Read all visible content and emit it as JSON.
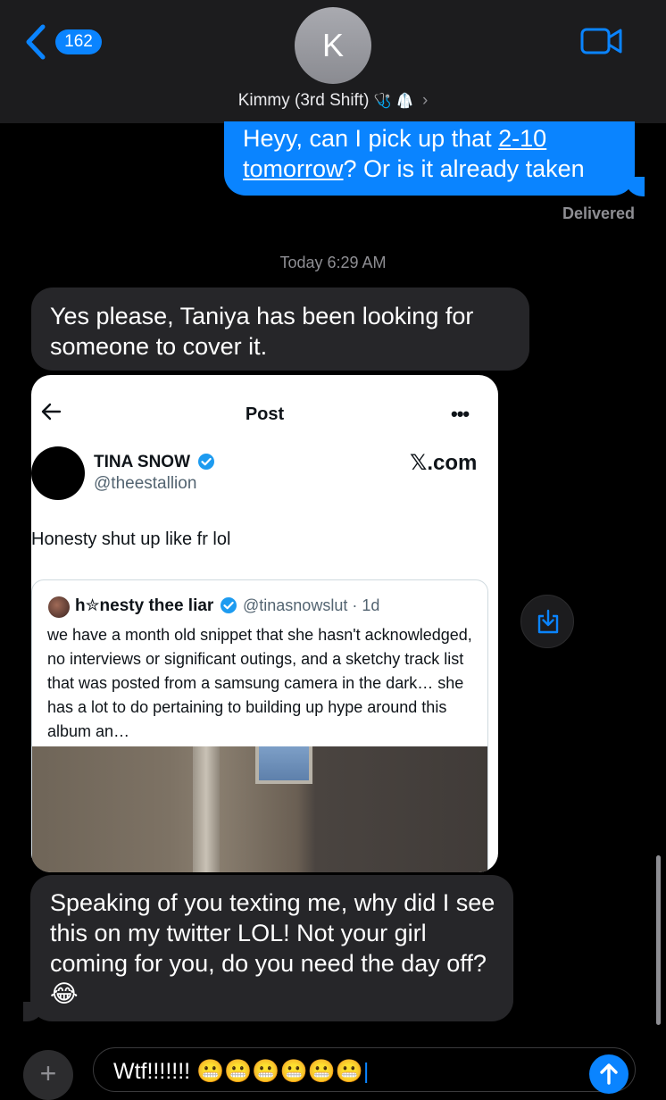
{
  "header": {
    "unread_count": "162",
    "avatar_initial": "K",
    "contact_name": "Kimmy (3rd Shift)",
    "contact_emoji": "🩺 🥼",
    "chevron": "›"
  },
  "messages": {
    "sent_1": {
      "text_before_link": "Heyy, can I pick up that ",
      "link_text": "2-10 tomorrow",
      "text_after_link": "? Or is it already taken",
      "status": "Delivered"
    },
    "timestamp": "Today 6:29 AM",
    "received_1": "Yes please, Taniya has been looking for someone to cover it.",
    "received_2": "Speaking of you texting me, why did I see this on my twitter LOL! Not your girl coming for you, do you need the day off? 😂"
  },
  "tweet": {
    "page_title": "Post",
    "more_label": "•••",
    "author_name": "TINA SNOW",
    "author_handle": "@theestallion",
    "site_label": "𝕏.com",
    "text": "Honesty shut up like fr lol",
    "quote": {
      "author_name": "h✮nesty thee liar",
      "meta": "@tinasnowslut · 1d",
      "text": "we have a month old snippet that she hasn't acknowledged, no interviews or significant outings, and a sketchy track list that was posted from a samsung camera in the dark… she has a lot to do pertaining to building up hype around this album an…"
    }
  },
  "compose": {
    "plus_label": "+",
    "text": "Wtf!!!!!!! 😬😬😬😬😬😬"
  },
  "colors": {
    "accent": "#0a84ff",
    "received_bubble": "#262629",
    "header_bg": "#1c1c1e",
    "twitter_verified": "#1d9bf0"
  },
  "icons": {
    "back": "chevron-left-icon",
    "video": "video-camera-icon",
    "share": "save-to-device-icon",
    "send": "arrow-up-icon"
  }
}
